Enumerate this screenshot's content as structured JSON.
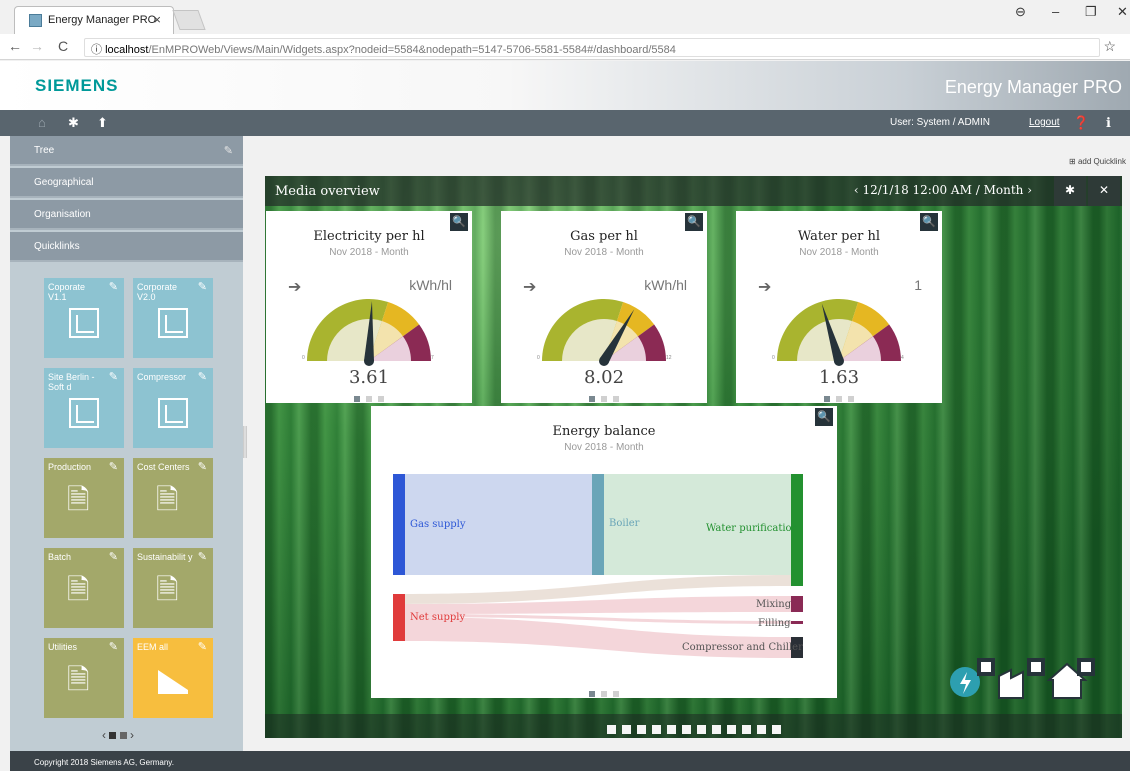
{
  "browser": {
    "tab_title": "Energy Manager PRO",
    "url_host": "localhost",
    "url_path": "/EnMPROWeb/Views/Main/Widgets.aspx?nodeid=5584&nodepath=5147-5706-5581-5584#/dashboard/5584"
  },
  "header": {
    "logo": "SIEMENS",
    "app_name": "Energy Manager PRO"
  },
  "toolbar": {
    "user": "User: System / ADMIN",
    "logout": "Logout"
  },
  "sidebar": {
    "nav": [
      "Tree",
      "Geographical",
      "Organisation",
      "Quicklinks"
    ],
    "tiles": [
      {
        "label": "Coporate V1.1",
        "color": "#8dc3d1",
        "icon": "report-icon"
      },
      {
        "label": "Corporate V2.0",
        "color": "#8dc3d1",
        "icon": "report-icon"
      },
      {
        "label": "Site Berlin - Soft d",
        "color": "#8dc3d1",
        "icon": "report-icon"
      },
      {
        "label": "Compressor",
        "color": "#8dc3d1",
        "icon": "report-icon"
      },
      {
        "label": "Production",
        "color": "#a3a86a",
        "icon": "document-icon"
      },
      {
        "label": "Cost Centers",
        "color": "#a3a86a",
        "icon": "document-icon"
      },
      {
        "label": "Batch",
        "color": "#a3a86a",
        "icon": "document-icon"
      },
      {
        "label": "Sustainabilit y",
        "color": "#a3a86a",
        "icon": "document-icon"
      },
      {
        "label": "Utilities",
        "color": "#a3a86a",
        "icon": "document-icon"
      },
      {
        "label": "EEM all",
        "color": "#f7be3e",
        "icon": "chart-icon"
      }
    ]
  },
  "main": {
    "add_quicklink": "add Quicklink"
  },
  "dashboard": {
    "title": "Media overview",
    "date": "12/1/18 12:00 AM",
    "separator": "/",
    "period": "Month"
  },
  "gauges": [
    {
      "title": "Electricity per hl",
      "subtitle": "Nov 2018 - Month",
      "unit": "kWh/hl",
      "value": "3.61",
      "min": "0",
      "max": "7",
      "value_num": 3.61,
      "max_num": 7
    },
    {
      "title": "Gas per hl",
      "subtitle": "Nov 2018 - Month",
      "unit": "kWh/hl",
      "value": "8.02",
      "min": "0",
      "max": "12",
      "value_num": 8.02,
      "max_num": 12
    },
    {
      "title": "Water per hl",
      "subtitle": "Nov 2018 - Month",
      "unit": "1",
      "value": "1.63",
      "min": "0",
      "max": "4",
      "value_num": 1.63,
      "max_num": 4
    }
  ],
  "energy_balance": {
    "title": "Energy balance",
    "subtitle": "Nov 2018 - Month",
    "nodes": [
      "Gas supply",
      "Boiler",
      "Water purification",
      "Net supply",
      "Mixing",
      "Filling",
      "Compressor and Chiller"
    ]
  },
  "colors": {
    "gauge_green": "#a9b42f",
    "gauge_yellow": "#e5b722",
    "gauge_maroon": "#8b2a54",
    "siemens": "#009999"
  },
  "footer": "Copyright 2018 Siemens AG, Germany."
}
